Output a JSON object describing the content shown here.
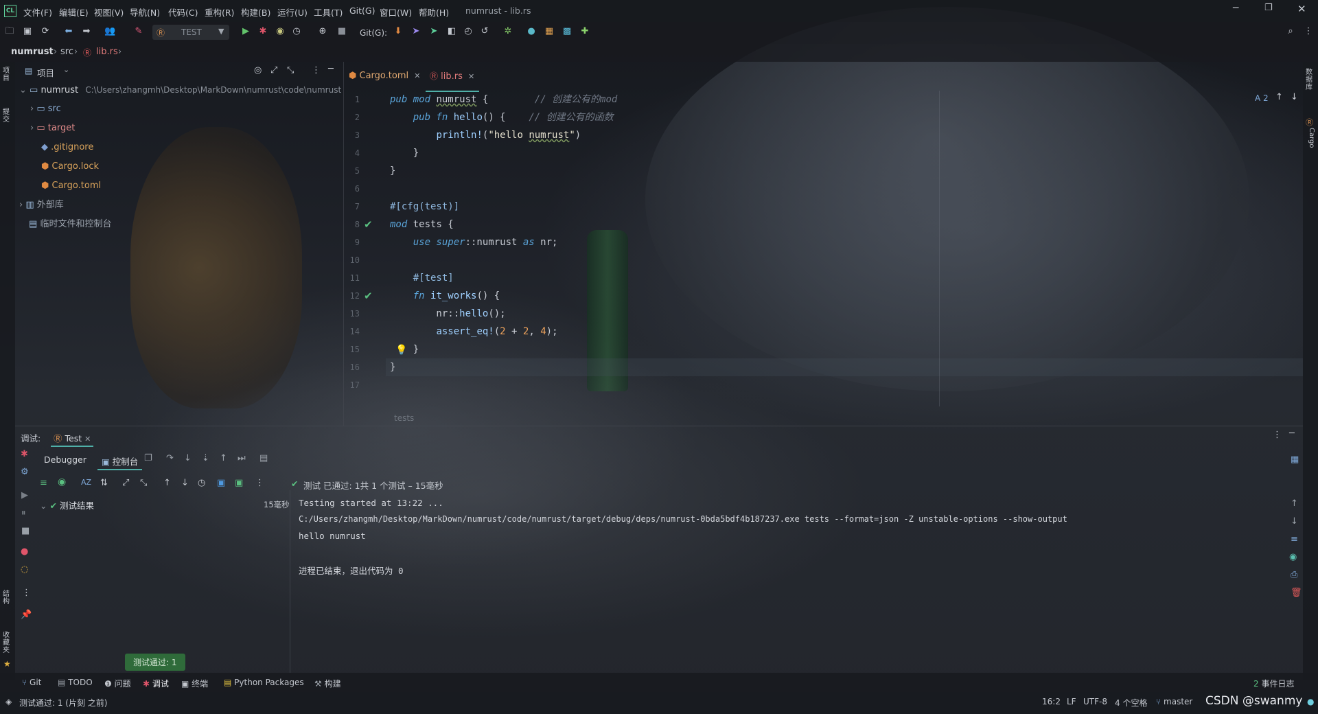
{
  "menu": {
    "items": [
      "文件(F)",
      "编辑(E)",
      "视图(V)",
      "导航(N)",
      "代码(C)",
      "重构(R)",
      "构建(B)",
      "运行(U)",
      "工具(T)",
      "Git(G)",
      "窗口(W)",
      "帮助(H)"
    ],
    "window_title": "numrust - lib.rs"
  },
  "toolbar": {
    "run_config": "TEST",
    "git_label": "Git(G):"
  },
  "breadcrumb": {
    "project": "numrust",
    "folder": "src",
    "file": "lib.rs"
  },
  "project_panel": {
    "title": "项目",
    "root_name": "numrust",
    "root_path": "C:\\Users\\zhangmh\\Desktop\\MarkDown\\numrust\\code\\numrust",
    "items": [
      {
        "label": "src",
        "color": "#8fb0d8"
      },
      {
        "label": "target",
        "color": "#e08a8a"
      },
      {
        "label": ".gitignore",
        "color": "#d9a35b"
      },
      {
        "label": "Cargo.lock",
        "color": "#d9a35b"
      },
      {
        "label": "Cargo.toml",
        "color": "#d9a35b"
      },
      {
        "label": "外部库",
        "color": "#9aa1ab"
      },
      {
        "label": "临时文件和控制台",
        "color": "#9aa1ab"
      }
    ]
  },
  "editor": {
    "tabs": [
      {
        "label": "Cargo.toml"
      },
      {
        "label": "lib.rs"
      }
    ],
    "line_numbers": [
      "1",
      "2",
      "3",
      "4",
      "5",
      "6",
      "7",
      "8",
      "9",
      "10",
      "11",
      "12",
      "13",
      "14",
      "15",
      "16",
      "17"
    ],
    "inspection_count": "2",
    "footer_context": "tests",
    "comments": {
      "mod": "// 创建公有的mod",
      "fn": "// 创建公有的函数"
    }
  },
  "debug_panel": {
    "label": "调试:",
    "run_tab": "Test",
    "subtabs": [
      "Debugger",
      "控制台"
    ],
    "status_text": "测试 已通过: 1共 1 个测试 – 15毫秒",
    "tree_root": "测试结果",
    "tree_time": "15毫秒",
    "output_lines": [
      "Testing started at 13:22 ...",
      "C:/Users/zhangmh/Desktop/MarkDown/numrust/code/numrust/target/debug/deps/numrust-0bda5bdf4b187237.exe tests --format=json -Z unstable-options --show-output",
      "hello numrust",
      "",
      "进程已结束，退出代码为 0"
    ],
    "tooltip": "测试通过: 1"
  },
  "tool_windows": [
    "Git",
    "TODO",
    "问题",
    "调试",
    "终端",
    "Python Packages",
    "构建"
  ],
  "event_log": {
    "count": "2",
    "label": "事件日志"
  },
  "status_bar": {
    "message": "测试通过: 1 (片刻 之前)",
    "position": "16:2",
    "line_sep": "LF",
    "encoding": "UTF-8",
    "indent": "4 个空格",
    "branch": "master",
    "watermark": "CSDN @swanmy"
  },
  "side_labels": {
    "left_top": "项目",
    "left_mid": "提交",
    "left_bottom1": "结构",
    "left_bottom2": "收藏夹",
    "right_top": "数据库",
    "right_mid": "Cargo"
  }
}
